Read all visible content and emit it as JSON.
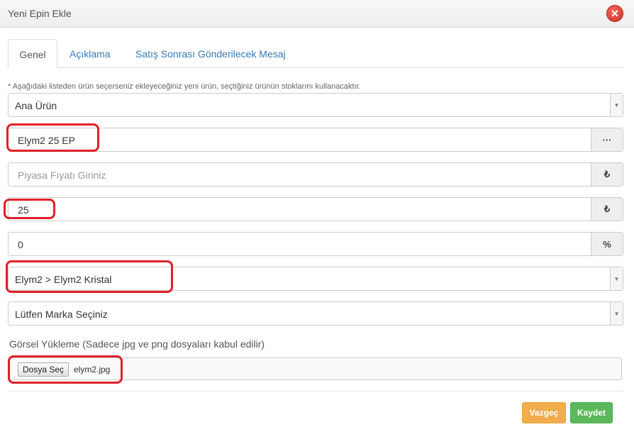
{
  "modal": {
    "title": "Yeni Epin Ekle",
    "close_icon": "close-icon"
  },
  "tabs": [
    {
      "label": "Genel",
      "active": true
    },
    {
      "label": "Açıklama",
      "active": false
    },
    {
      "label": "Satış Sonrası Gönderilecek Mesaj",
      "active": false
    }
  ],
  "form": {
    "note": "* Aşağıdaki listeden ürün seçerseniz ekleyeceğiniz yeni ürün, seçtiğiniz ürünün stoklarını kullanacaktır.",
    "parent_product": {
      "value": "Ana Ürün"
    },
    "product_name": {
      "value": "Elym2 25 EP",
      "addon": "···"
    },
    "market_price": {
      "placeholder": "Piyasa Fıyatı Giriniz",
      "addon": "₺"
    },
    "price": {
      "value": "25",
      "addon": "₺"
    },
    "discount": {
      "value": "0",
      "addon": "%"
    },
    "category": {
      "value": "Elym2 > Elym2 Kristal"
    },
    "brand": {
      "value": "Lütfen Marka Seçiniz"
    },
    "upload": {
      "label": "Görsel Yükleme (Sadece jpg ve png dosyaları kabul edilir)",
      "button": "Dosya Seç",
      "file_name": "elym2.jpg"
    }
  },
  "actions": {
    "cancel": "Vazgeç",
    "save": "Kaydet"
  },
  "colors": {
    "highlight": "#e0202a",
    "cancel": "#f0ad4e",
    "save": "#5cb85c",
    "link": "#337ab7"
  }
}
